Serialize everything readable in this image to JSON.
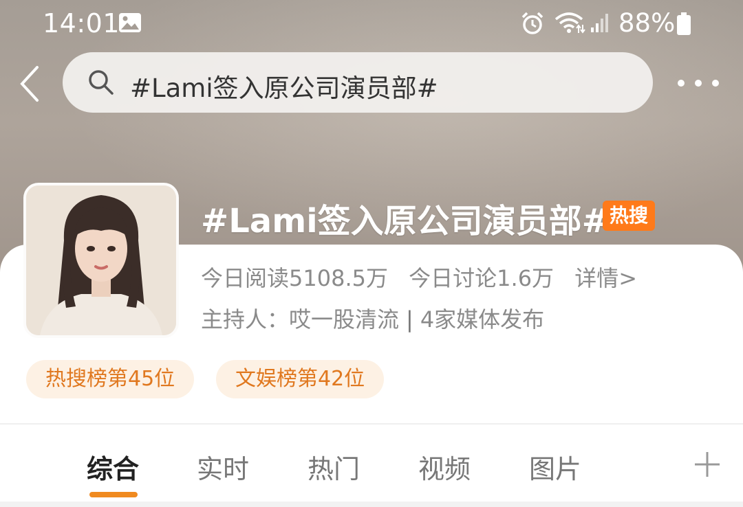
{
  "status_bar": {
    "time": "14:01",
    "battery_percent": "88%",
    "icons": [
      "gallery-icon",
      "alarm-icon",
      "wifi-icon",
      "signal-icon",
      "battery-icon"
    ]
  },
  "nav": {
    "search_text": "#Lami签入原公司演员部#",
    "back_icon": "chevron-left-icon",
    "more_icon": "more-dots-icon"
  },
  "topic": {
    "title": "#Lami签入原公司演员部#",
    "hot_badge": "热搜",
    "reads": "今日阅读5108.5万",
    "discussions": "今日讨论1.6万",
    "details": "详情>",
    "host_label": "主持人：",
    "host_name": "哎一股清流",
    "separator": "|",
    "media_count": "4家媒体发布"
  },
  "ranks": [
    {
      "label": "热搜榜第45位"
    },
    {
      "label": "文娱榜第42位"
    }
  ],
  "tabs": [
    {
      "label": "综合",
      "active": true
    },
    {
      "label": "实时",
      "active": false
    },
    {
      "label": "热门",
      "active": false
    },
    {
      "label": "视频",
      "active": false
    },
    {
      "label": "图片",
      "active": false
    }
  ],
  "colors": {
    "accent": "#f08a1f",
    "hot_badge": "#ff7a1a",
    "rank_chip_bg": "#fdf1e4",
    "rank_chip_text": "#e0781f"
  }
}
